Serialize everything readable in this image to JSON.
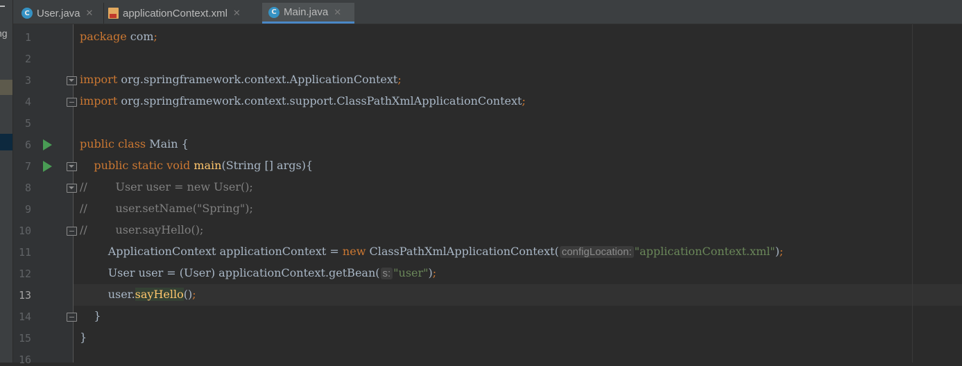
{
  "sidebar": {
    "partial_text": "ng"
  },
  "tabs": [
    {
      "label": "User.java",
      "icon": "java-class-icon",
      "active": false
    },
    {
      "label": "applicationContext.xml",
      "icon": "xml-file-icon",
      "active": false
    },
    {
      "label": "Main.java",
      "icon": "java-class-icon",
      "active": true
    }
  ],
  "editor": {
    "current_line": 13,
    "line_numbers": [
      "1",
      "2",
      "3",
      "4",
      "5",
      "6",
      "7",
      "8",
      "9",
      "10",
      "11",
      "12",
      "13",
      "14",
      "15",
      "16"
    ],
    "lines": [
      {
        "n": 1,
        "tokens": [
          [
            "kw",
            "package"
          ],
          [
            "p",
            " com"
          ],
          [
            "kw",
            ";"
          ]
        ]
      },
      {
        "n": 2,
        "tokens": []
      },
      {
        "n": 3,
        "tokens": [
          [
            "kw",
            "import"
          ],
          [
            "p",
            " org.springframework.context.ApplicationContext"
          ],
          [
            "kw",
            ";"
          ]
        ]
      },
      {
        "n": 4,
        "tokens": [
          [
            "kw",
            "import"
          ],
          [
            "p",
            " org.springframework.context.support.ClassPathXmlApplicationContext"
          ],
          [
            "kw",
            ";"
          ]
        ]
      },
      {
        "n": 5,
        "tokens": []
      },
      {
        "n": 6,
        "tokens": [
          [
            "kw",
            "public class"
          ],
          [
            "p",
            " Main {"
          ]
        ]
      },
      {
        "n": 7,
        "tokens": [
          [
            "p",
            "    "
          ],
          [
            "kw",
            "public static void"
          ],
          [
            "p",
            " "
          ],
          [
            "fn",
            "main"
          ],
          [
            "p",
            "(String [] args){"
          ]
        ]
      },
      {
        "n": 8,
        "tokens": [
          [
            "cm",
            "//        User user = new User();"
          ]
        ]
      },
      {
        "n": 9,
        "tokens": [
          [
            "cm",
            "//        user.setName(\"Spring\");"
          ]
        ]
      },
      {
        "n": 10,
        "tokens": [
          [
            "cm",
            "//        user.sayHello();"
          ]
        ]
      },
      {
        "n": 11,
        "tokens": [
          [
            "p",
            "        ApplicationContext applicationContext = "
          ],
          [
            "kw",
            "new"
          ],
          [
            "p",
            " ClassPathXmlApplicationContext("
          ],
          [
            "hint",
            "configLocation:"
          ],
          [
            "str",
            "\"applicationContext.xml\""
          ],
          [
            "p",
            ")"
          ],
          [
            "kw",
            ";"
          ]
        ]
      },
      {
        "n": 12,
        "tokens": [
          [
            "p",
            "        User user = (User) applicationContext.getBean("
          ],
          [
            "hint",
            "s:"
          ],
          [
            "str",
            "\"user\""
          ],
          [
            "p",
            ")"
          ],
          [
            "kw",
            ";"
          ]
        ]
      },
      {
        "n": 13,
        "tokens": [
          [
            "p",
            "        user."
          ],
          [
            "fnhl",
            "sayHello"
          ],
          [
            "p",
            "()"
          ],
          [
            "kw",
            ";"
          ]
        ]
      },
      {
        "n": 14,
        "tokens": [
          [
            "p",
            "    }"
          ]
        ]
      },
      {
        "n": 15,
        "tokens": [
          [
            "p",
            "}"
          ]
        ]
      },
      {
        "n": 16,
        "tokens": []
      }
    ],
    "run_markers": [
      6,
      7
    ],
    "fold_markers": [
      {
        "line": 3,
        "dir": "down"
      },
      {
        "line": 4,
        "dir": "up"
      },
      {
        "line": 7,
        "dir": "down"
      },
      {
        "line": 8,
        "dir": "down"
      },
      {
        "line": 10,
        "dir": "up"
      },
      {
        "line": 14,
        "dir": "up"
      }
    ]
  },
  "colors": {
    "keyword": "#cc7832",
    "string": "#6a8759",
    "comment": "#808080",
    "method": "#ffc66d",
    "text": "#a9b7c6",
    "run": "#499c54",
    "tab_underline": "#4a88c7"
  }
}
